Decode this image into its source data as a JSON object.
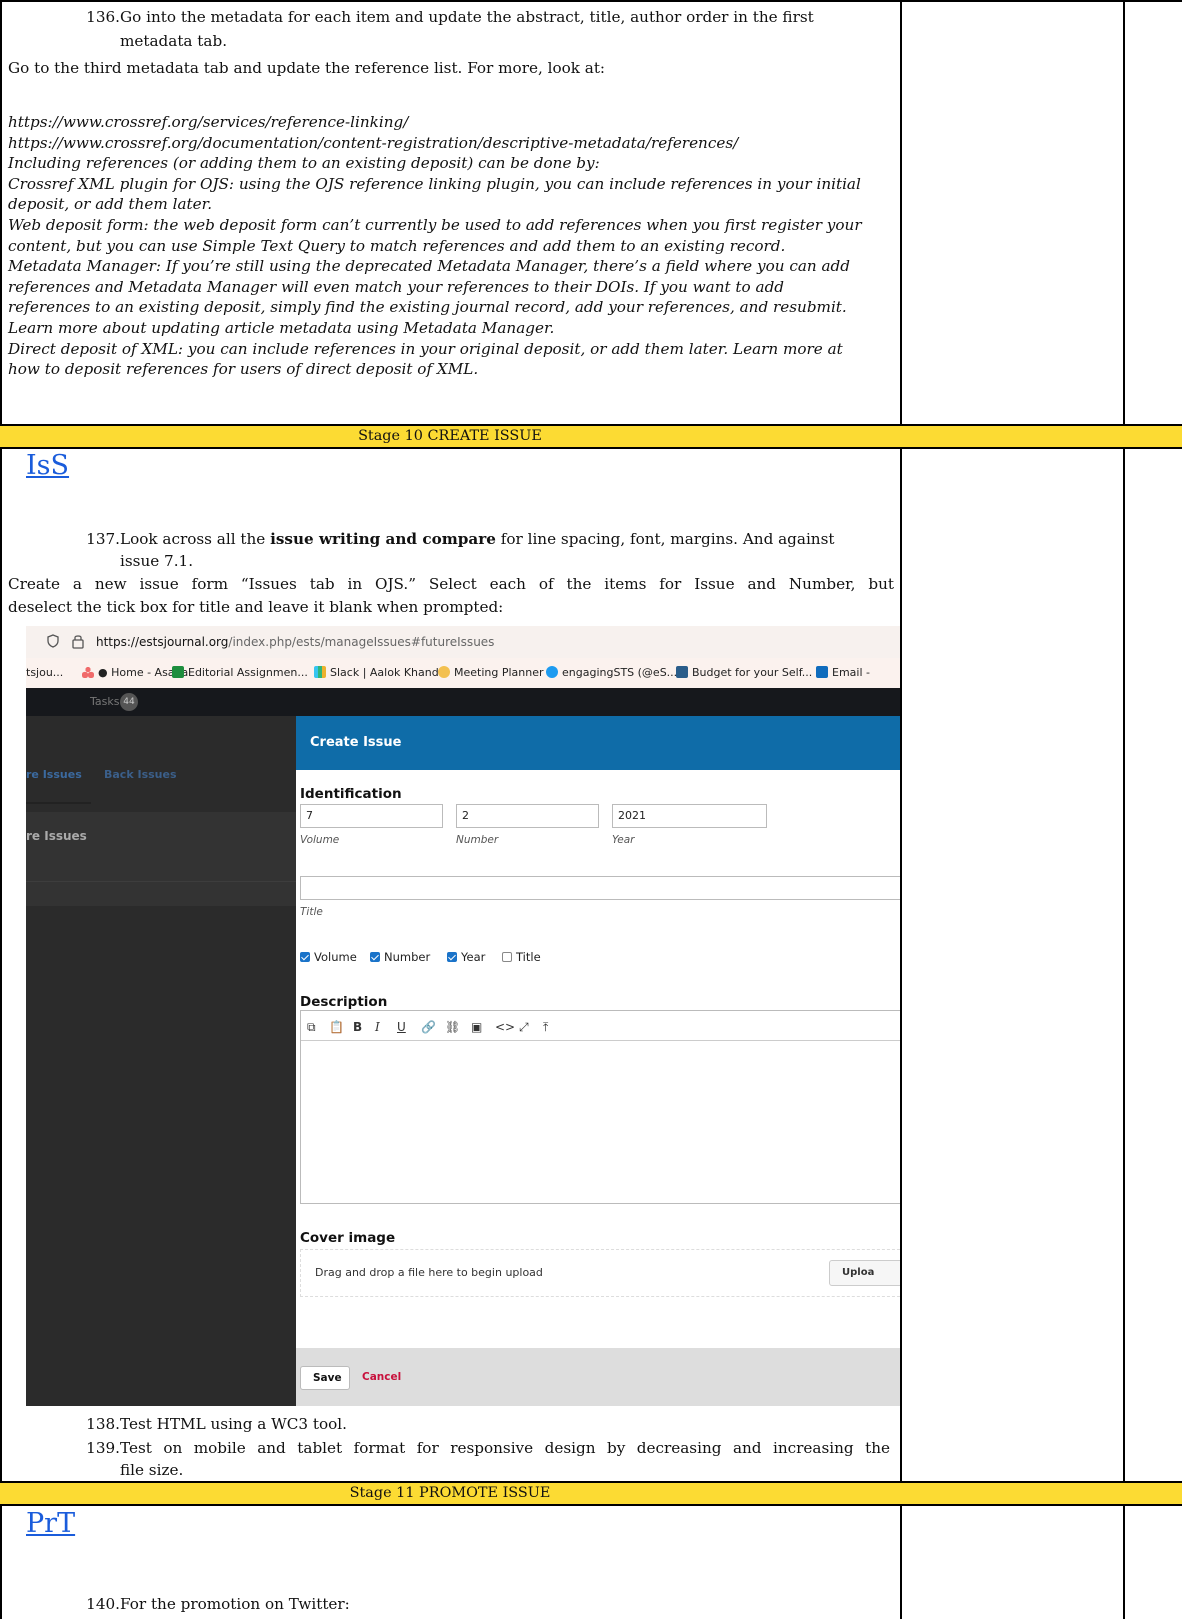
{
  "items": [
    {
      "num": "136.",
      "lines": [
        "Go into the metadata for each item and update the abstract, title, author order in the first",
        "metadata tab."
      ]
    },
    {
      "num": "137.",
      "text_a": "Look across all the ",
      "text_b": "issue writing and compare",
      "text_c": " for line spacing, font, margins. And against",
      "line2": "issue 7.1."
    },
    {
      "num": "138.",
      "lines": [
        "Test HTML using a WC3 tool."
      ]
    },
    {
      "num": "139.",
      "lines": [
        "Test on mobile and tablet format for responsive design by decreasing and increasing the",
        "file size."
      ]
    },
    {
      "num": "140.",
      "lines": [
        "For the promotion on Twitter:"
      ]
    }
  ],
  "para_reference": "Go to the third metadata tab and update the reference list. For more, look at:",
  "italic_lines": [
    "https://www.crossref.org/services/reference-linking/",
    "https://www.crossref.org/documentation/content-registration/descriptive-metadata/references/",
    "Including references (or adding them to an existing deposit) can be done by:",
    "Crossref XML plugin for OJS: using the OJS reference linking plugin, you can include references in your initial",
    "deposit, or add them later.",
    "Web deposit form: the web deposit form can’t currently be used to add references when you first register your",
    "content, but you can use Simple Text Query to match references and add them to an existing record.",
    "Metadata Manager: If you’re still using the deprecated Metadata Manager, there’s a field where you can add",
    "references and Metadata Manager will even match your references to their DOIs. If you want to add",
    "references to an existing deposit, simply find the existing journal record, add your references, and resubmit.",
    "Learn more about updating article metadata using Metadata Manager.",
    "Direct deposit of XML: you can include references in your original deposit, or add them later. Learn more at",
    "how to deposit references for users of direct deposit of XML."
  ],
  "stage10": "Stage 10 CREATE ISSUE",
  "stage11": "Stage 11 PROMOTE ISSUE",
  "code_iss": "IsS",
  "code_prt": "PrT",
  "create_para": [
    "Create a new issue form “Issues tab in OJS.” Select each of the items for Issue and Number, but",
    "deselect the tick box for title and leave it blank when prompted:"
  ],
  "screenshot": {
    "url_domain": "https://estsjournal.org",
    "url_path": "/index.php/ests/manageIssues#futureIssues",
    "bookmarks": [
      "tsjou...",
      "Home - Asana",
      "Editorial Assignmen...",
      "Slack | Aalok Khand...",
      "Meeting Planner",
      "engagingSTS (@eS...",
      "Budget for your Self...",
      "Email -"
    ],
    "tasks_label": "Tasks",
    "tasks_count": "44",
    "tab_future": "re Issues",
    "tab_back": "Back Issues",
    "left_heading": "re Issues",
    "modal_title": "Create Issue",
    "identification": "Identification",
    "volume_value": "7",
    "number_value": "2",
    "year_value": "2021",
    "volume_label": "Volume",
    "number_label": "Number",
    "year_label": "Year",
    "title_label": "Title",
    "check_volume": "Volume",
    "check_number": "Number",
    "check_year": "Year",
    "check_title": "Title",
    "description": "Description",
    "cover_image": "Cover image",
    "drag_drop": "Drag and drop a file here to begin upload",
    "upload_btn": "Uploa",
    "save_btn": "Save",
    "cancel_btn": "Cancel",
    "colors": {
      "header": "#0f6ca8",
      "cancel": "#c8103c",
      "check": "#1a73c9"
    }
  }
}
